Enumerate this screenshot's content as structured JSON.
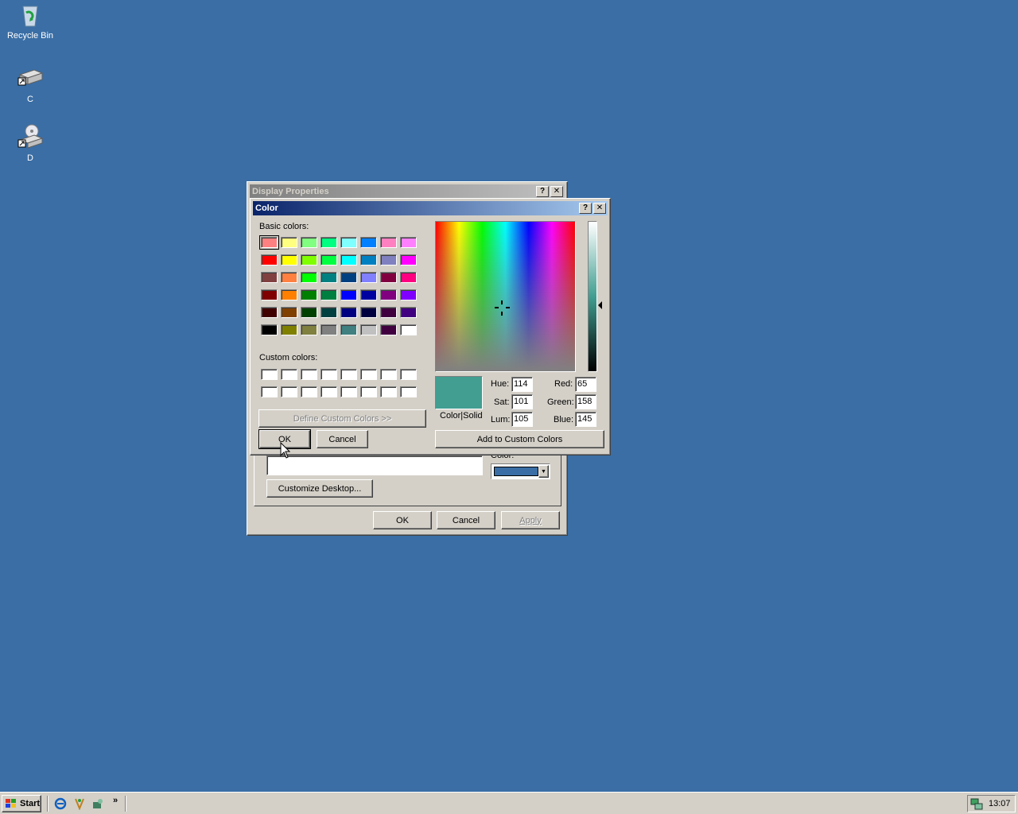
{
  "desktop": {
    "icons": [
      {
        "label": "Recycle Bin",
        "icon": "recycle-bin-icon"
      },
      {
        "label": "C",
        "icon": "hard-drive-icon"
      },
      {
        "label": "D",
        "icon": "cd-drive-icon"
      }
    ]
  },
  "display_properties": {
    "title": "Display Properties",
    "customize_desktop": "Customize Desktop...",
    "color_label": "Color:",
    "color_value": "#3a6ea5",
    "ok": "OK",
    "cancel": "Cancel",
    "apply": "Apply"
  },
  "color_dialog": {
    "title": "Color",
    "basic_colors_label": "Basic colors:",
    "custom_colors_label": "Custom colors:",
    "define_custom": "Define Custom Colors >>",
    "ok": "OK",
    "cancel": "Cancel",
    "add_custom": "Add to Custom Colors",
    "color_solid_label": "Color|Solid",
    "current_color": "#419e91",
    "basic_colors": [
      "#ff8080",
      "#ffff80",
      "#80ff80",
      "#00ff80",
      "#80ffff",
      "#0080ff",
      "#ff80c0",
      "#ff80ff",
      "#ff0000",
      "#ffff00",
      "#80ff00",
      "#00ff40",
      "#00ffff",
      "#0080c0",
      "#8080c0",
      "#ff00ff",
      "#804040",
      "#ff8040",
      "#00ff00",
      "#008080",
      "#004080",
      "#8080ff",
      "#800040",
      "#ff0080",
      "#800000",
      "#ff8000",
      "#008000",
      "#008040",
      "#0000ff",
      "#0000a0",
      "#800080",
      "#8000ff",
      "#400000",
      "#804000",
      "#004000",
      "#004040",
      "#000080",
      "#000040",
      "#400040",
      "#400080",
      "#000000",
      "#808000",
      "#808040",
      "#808080",
      "#408080",
      "#c0c0c0",
      "#400040",
      "#ffffff"
    ],
    "hue_label": "Hue:",
    "hue": "114",
    "sat_label": "Sat:",
    "sat": "101",
    "lum_label": "Lum:",
    "lum": "105",
    "red_label": "Red:",
    "red": "65",
    "green_label": "Green:",
    "green": "158",
    "blue_label": "Blue:",
    "blue": "145"
  },
  "taskbar": {
    "start": "Start",
    "chevron": "»",
    "clock": "13:07",
    "quick_launch": [
      "ie-icon",
      "outlook-icon",
      "tool-icon"
    ]
  }
}
